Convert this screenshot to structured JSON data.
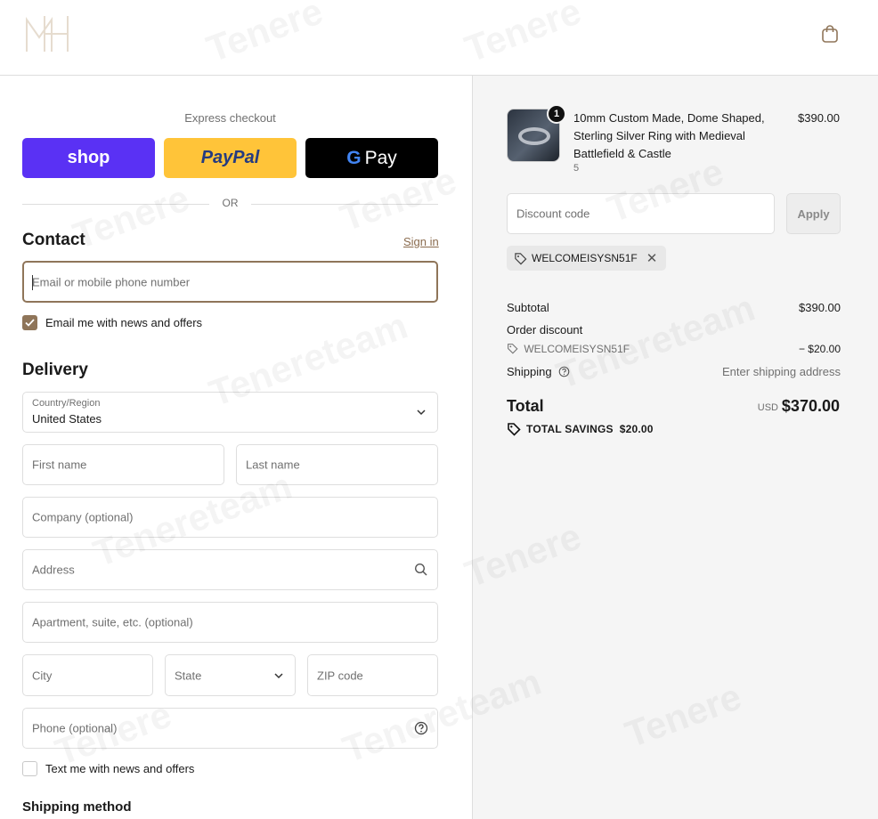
{
  "header": {
    "logo_name": "brand-logo",
    "cart_icon": "shopping-bag-icon"
  },
  "express": {
    "title": "Express checkout",
    "shop_label": "shop",
    "paypal_label": "PayPal",
    "gpay_g": "G",
    "gpay_label": "Pay",
    "or_label": "OR"
  },
  "contact": {
    "title": "Contact",
    "signin_label": "Sign in",
    "email_placeholder": "Email or mobile phone number",
    "news_label": "Email me with news and offers",
    "news_checked": true
  },
  "delivery": {
    "title": "Delivery",
    "country_label": "Country/Region",
    "country_value": "United States",
    "first_name": "First name",
    "last_name": "Last name",
    "company": "Company (optional)",
    "address": "Address",
    "apartment": "Apartment, suite, etc. (optional)",
    "city": "City",
    "state": "State",
    "zip": "ZIP code",
    "phone": "Phone (optional)",
    "text_label": "Text me with news and offers",
    "text_checked": false
  },
  "shipping_method_title": "Shipping method",
  "summary": {
    "product": {
      "name": "10mm Custom Made, Dome Shaped, Sterling Silver Ring with Medieval Battlefield & Castle",
      "variant": "5",
      "price": "$390.00",
      "quantity": "1"
    },
    "discount_placeholder": "Discount code",
    "apply_label": "Apply",
    "applied_code": "WELCOMEISYSN51F",
    "subtotal_label": "Subtotal",
    "subtotal_value": "$390.00",
    "order_discount_label": "Order discount",
    "discount_code": "WELCOMEISYSN51F",
    "discount_value": "− $20.00",
    "shipping_label": "Shipping",
    "shipping_value": "Enter shipping address",
    "total_label": "Total",
    "currency": "USD",
    "total_value": "$370.00",
    "savings_label": "TOTAL SAVINGS",
    "savings_value": "$20.00"
  },
  "colors": {
    "accent": "#8f7559",
    "shop": "#5a31f4",
    "paypal": "#ffc439"
  }
}
